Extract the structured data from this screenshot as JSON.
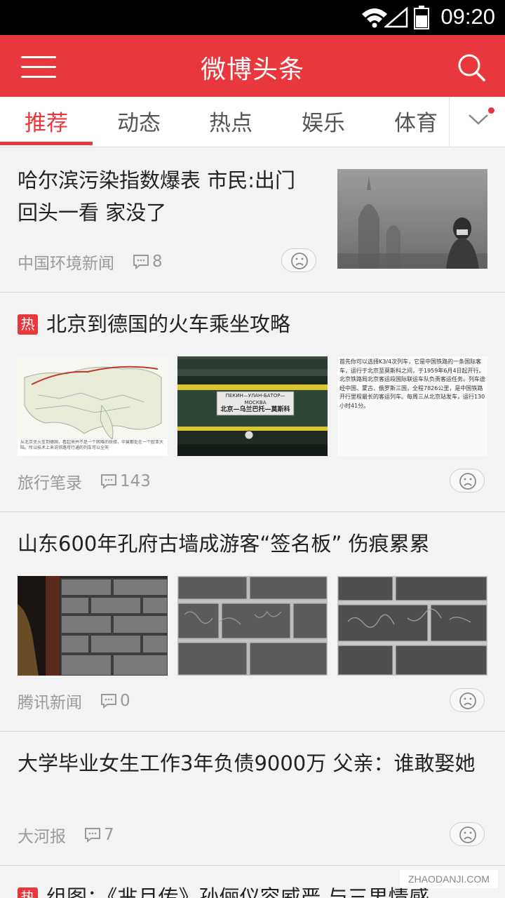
{
  "status_bar": {
    "time": "09:20"
  },
  "app_bar": {
    "title": "微博头条"
  },
  "tabs": [
    {
      "label": "推荐",
      "active": true
    },
    {
      "label": "动态",
      "active": false
    },
    {
      "label": "热点",
      "active": false
    },
    {
      "label": "娱乐",
      "active": false
    },
    {
      "label": "体育",
      "active": false
    }
  ],
  "feed": [
    {
      "title": "哈尔滨污染指数爆表 市民:出门回头一看 家没了",
      "source": "中国环境新闻",
      "comments": "8",
      "hot": false
    },
    {
      "title": "北京到德国的火车乘坐攻略",
      "source": "旅行笔录",
      "comments": "143",
      "hot": true,
      "hot_label": "热"
    },
    {
      "title": "山东600年孔府古墙成游客“签名板” 伤痕累累",
      "source": "腾讯新闻",
      "comments": "0",
      "hot": false
    },
    {
      "title": "大学毕业女生工作3年负债9000万 父亲：谁敢娶她",
      "source": "大河报",
      "comments": "7",
      "hot": false
    },
    {
      "title": "组图：《芈月传》孙俪仪容威严 与三男情感",
      "hot": true,
      "hot_label": "热"
    }
  ],
  "image_text": {
    "map_caption": "从北京坐火车到德国，看起来并不是一个困难的抉择，毕竟都处在一个欧亚大陆。所以技术上来说铁路可行通的列车可以全天",
    "train_sign_cn": "北京—乌兰巴托—莫斯科",
    "train_sign_ru": "ПЕКИН—УЛАН-БАТОР—МОСКВА",
    "doc_text": "首先你可以选择K3/4次列车，它是中国铁路的一条国际客车，运行于北京至莫斯科之间，于1959年6月4日起开行。北京铁路局北京客运段国际联运车队负责客运任务。列车途经中国、蒙古、俄罗斯三国，全程7826公里，是中国铁路开行里程最长的客运列车。每周三从北京站发车，运行130小时41分。"
  },
  "watermark": "ZHAODANJI.COM",
  "colors": {
    "brand_red": "#e8383d",
    "meta_gray": "#9a9a9a"
  }
}
